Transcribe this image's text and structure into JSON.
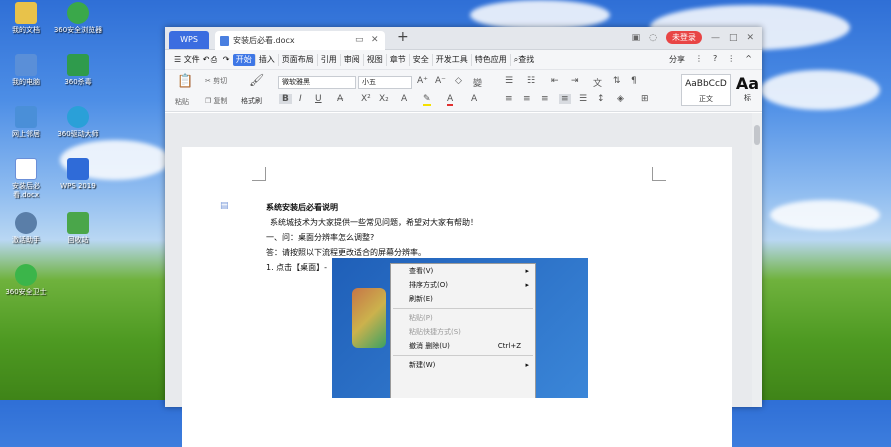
{
  "desktop_icons": [
    {
      "label": "我的文档",
      "color": "#e8c24a"
    },
    {
      "label": "360安全浏览器",
      "color": "#3aa84a"
    },
    {
      "label": "我的电脑",
      "color": "#5a8fd8"
    },
    {
      "label": "360杀毒",
      "color": "#2f9b4c"
    },
    {
      "label": "网上邻居",
      "color": "#4a8fd8"
    },
    {
      "label": "360驱动大师",
      "color": "#2aa0d8"
    },
    {
      "label": "安装后必看.docx",
      "color": "#ffffff"
    },
    {
      "label": "WPS 2019",
      "color": "#2f6bd8"
    },
    {
      "label": "激活助手",
      "color": "#5a7ea8"
    },
    {
      "label": "回收站",
      "color": "#4aa64a"
    },
    {
      "label": "360安全卫士",
      "color": "#3bb54a"
    }
  ],
  "window": {
    "wps_tab": "WPS",
    "doc_tab": "安装后必看.docx",
    "login": "未登录"
  },
  "menu": {
    "items": [
      "文件",
      "开始",
      "插入",
      "页面布局",
      "引用",
      "审阅",
      "视图",
      "章节",
      "安全",
      "开发工具",
      "特色应用"
    ],
    "search": "查找",
    "share": "分享"
  },
  "ribbon": {
    "paste": "粘贴",
    "cut": "剪切",
    "copy": "复制",
    "format_painter": "格式刷",
    "font": "微软雅黑",
    "size": "小五",
    "style_preview": "AaBbCcD",
    "style_name": "正文",
    "style2_preview": "Aa",
    "style2_name": "标"
  },
  "doc": {
    "title": "系统安装后必看说明",
    "line1": "系统城技术为大家提供一些常见问题，希望对大家有帮助！",
    "line2": "一、问：桌面分辨率怎么调整?",
    "line3": "答：请按照以下流程更改适合的屏幕分辨率。",
    "line4": "1.  点击【桌面】-【鼠标右键】-【屏幕分辨率】(如图 1)"
  },
  "context_menu": {
    "view": "查看(V)",
    "sort": "排序方式(O)",
    "refresh": "刷新(E)",
    "paste": "粘贴(P)",
    "paste_shortcut": "粘贴快捷方式(S)",
    "undo": "撤消 删除(U)",
    "undo_shortcut": "Ctrl+Z",
    "new": "新建(W)"
  }
}
